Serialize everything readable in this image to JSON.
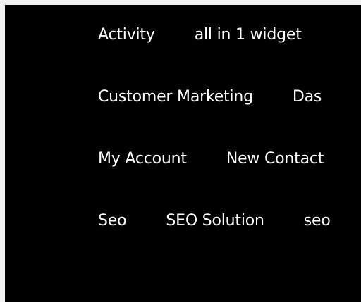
{
  "menu": {
    "rows": [
      [
        "Activity",
        "all in 1 widget"
      ],
      [
        "Customer Marketing",
        "Das"
      ],
      [
        "My Account",
        "New Contact"
      ],
      [
        "Seo",
        "SEO Solution",
        "seo"
      ]
    ]
  },
  "colors": {
    "panel_bg": "#000000",
    "text": "#ffffff",
    "border": "#f2f2f2"
  }
}
